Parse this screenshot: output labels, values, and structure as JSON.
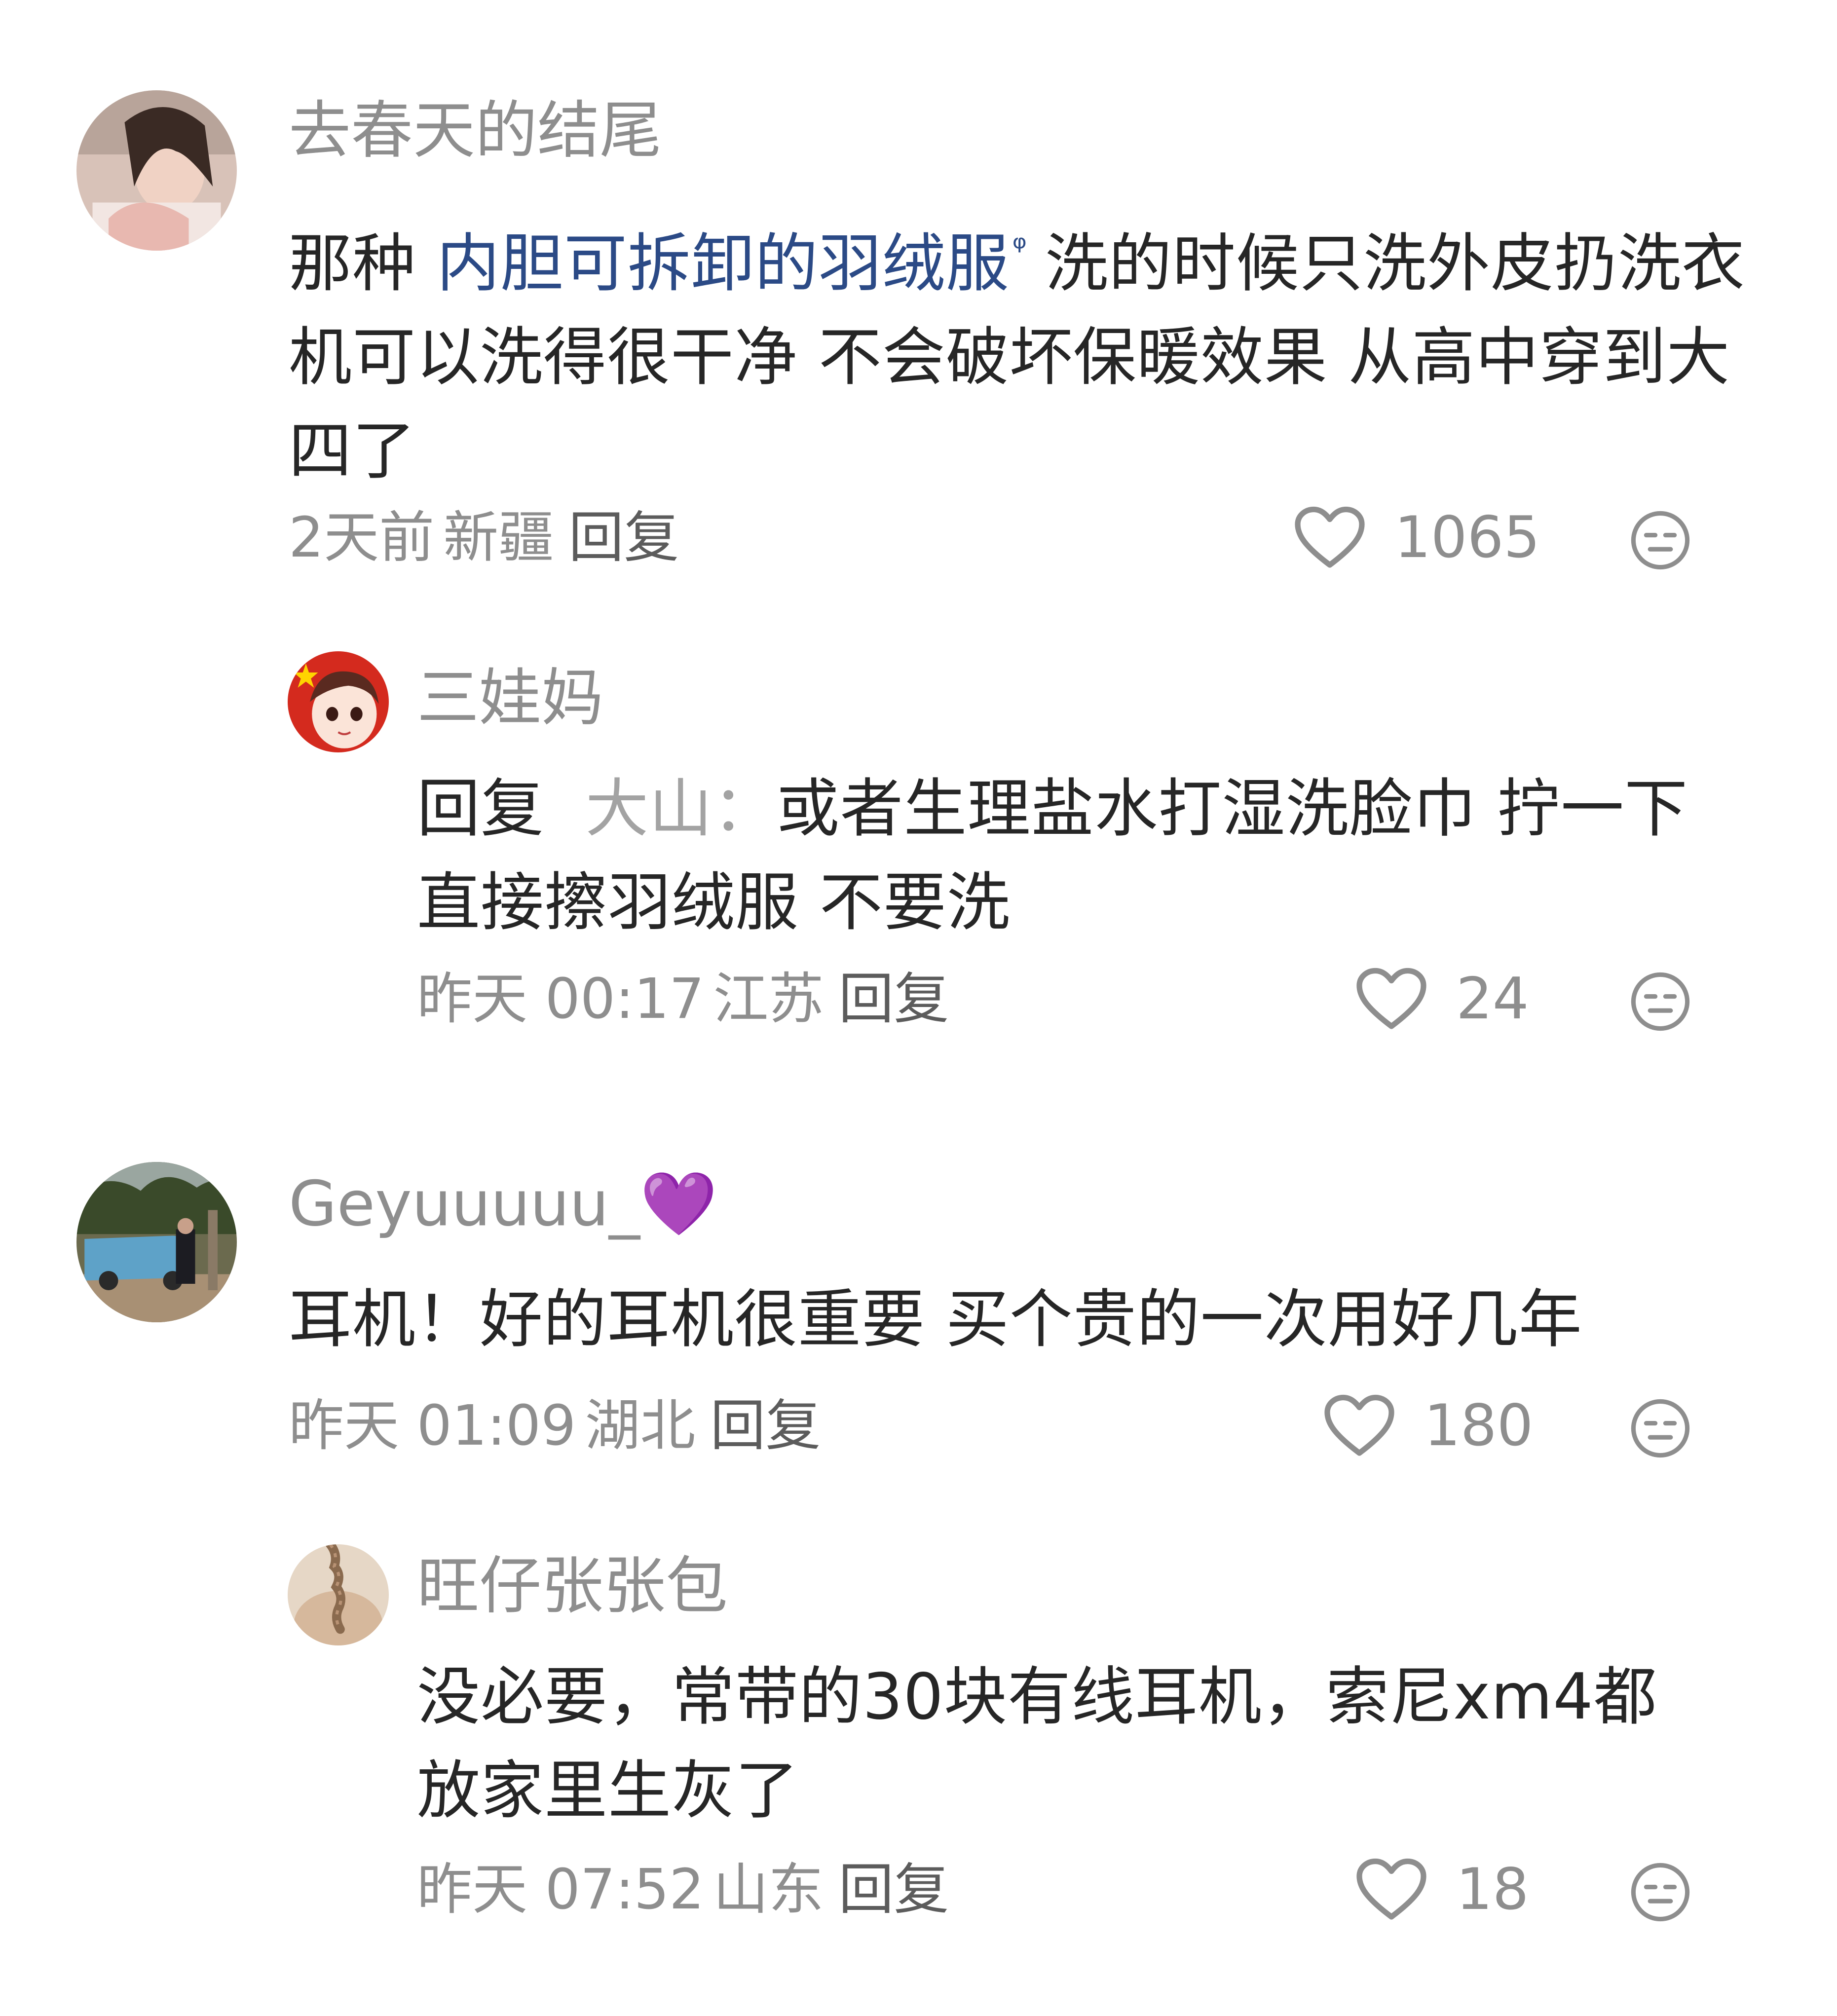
{
  "comments": [
    {
      "username": "去春天的结尾",
      "text_prefix": "那种 ",
      "highlight": "内胆可拆卸的羽绒服",
      "search_icon_glyph": "ᵠ",
      "text_rest": "洗的时候只洗外皮扔洗衣机可以洗得很干净 不会破坏保暖效果 从高中穿到大四了",
      "time": "2天前",
      "location": "新疆",
      "reply_label": "回复",
      "likes": "1065",
      "reply": {
        "username": "三娃妈",
        "reply_prefix": "回复",
        "reply_to": "大山",
        "colon": "：",
        "text": "或者生理盐水打湿洗脸巾 拧一下 直接擦羽绒服 不要洗",
        "time": "昨天 00:17",
        "location": "江苏",
        "reply_label": "回复",
        "likes": "24"
      }
    },
    {
      "username": "Geyuuuuu_💜",
      "text": "耳机！好的耳机很重要 买个贵的一次用好几年",
      "time": "昨天 01:09",
      "location": "湖北",
      "reply_label": "回复",
      "likes": "180",
      "reply": {
        "username": "旺仔张张包",
        "text": "没必要，常带的30块有线耳机，索尼xm4都放家里生灰了",
        "time": "昨天 07:52",
        "location": "山东",
        "reply_label": "回复",
        "likes": "18"
      }
    }
  ],
  "icons": {
    "like": "heart-outline-icon",
    "dislike": "neutral-face-icon",
    "search": "search-icon"
  },
  "colors": {
    "username": "#8e8e8e",
    "body": "#262626",
    "link": "#2b4a86",
    "meta": "#8e8e8e"
  }
}
